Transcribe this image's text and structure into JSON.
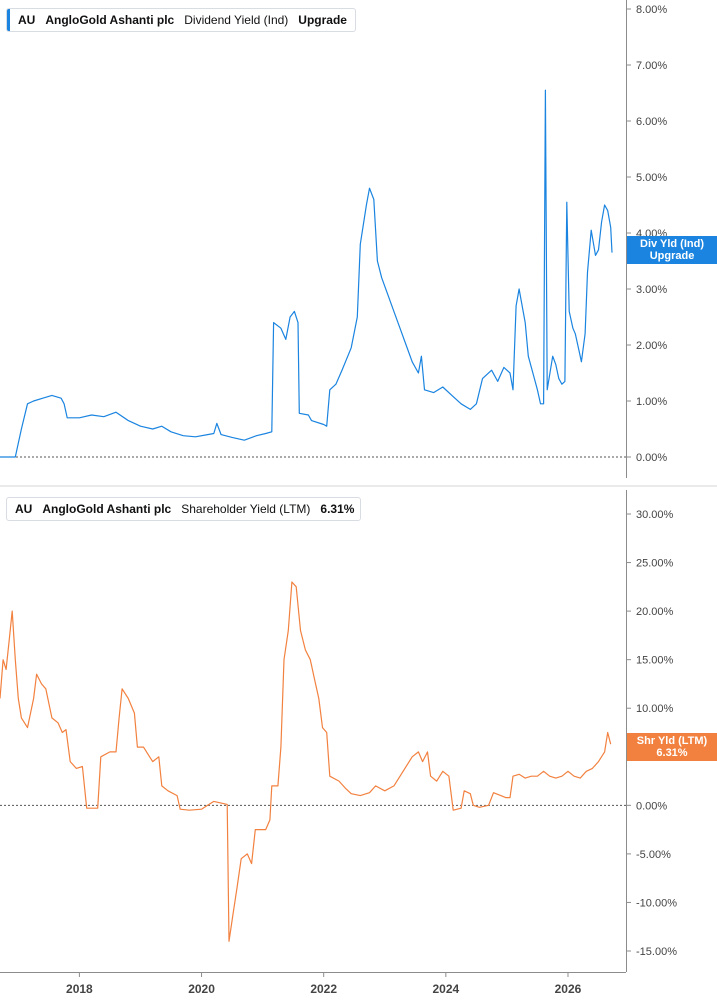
{
  "chart_data": [
    {
      "type": "line",
      "legend": {
        "ticker": "AU",
        "company": "AngloGold Ashanti plc",
        "metric": "Dividend Yield (Ind)",
        "value": "Upgrade"
      },
      "badge": {
        "line1": "Div Yld (Ind)",
        "line2": "Upgrade"
      },
      "color": "#1a84e0",
      "ylim": [
        0,
        8
      ],
      "yticks": [
        {
          "v": 0,
          "label": "0.00%"
        },
        {
          "v": 1,
          "label": "1.00%"
        },
        {
          "v": 2,
          "label": "2.00%"
        },
        {
          "v": 3,
          "label": "3.00%"
        },
        {
          "v": 4,
          "label": "4.00%"
        },
        {
          "v": 5,
          "label": "5.00%"
        },
        {
          "v": 6,
          "label": "6.00%"
        },
        {
          "v": 7,
          "label": "7.00%"
        },
        {
          "v": 8,
          "label": "8.00%"
        }
      ],
      "points": [
        [
          2016.7,
          0.0
        ],
        [
          2016.95,
          0.0
        ],
        [
          2017.05,
          0.5
        ],
        [
          2017.15,
          0.95
        ],
        [
          2017.25,
          1.0
        ],
        [
          2017.4,
          1.05
        ],
        [
          2017.55,
          1.1
        ],
        [
          2017.7,
          1.05
        ],
        [
          2017.75,
          0.95
        ],
        [
          2017.8,
          0.7
        ],
        [
          2018.0,
          0.7
        ],
        [
          2018.2,
          0.75
        ],
        [
          2018.4,
          0.72
        ],
        [
          2018.6,
          0.8
        ],
        [
          2018.8,
          0.65
        ],
        [
          2019.0,
          0.55
        ],
        [
          2019.2,
          0.5
        ],
        [
          2019.35,
          0.55
        ],
        [
          2019.5,
          0.45
        ],
        [
          2019.7,
          0.38
        ],
        [
          2019.9,
          0.36
        ],
        [
          2020.1,
          0.4
        ],
        [
          2020.2,
          0.42
        ],
        [
          2020.25,
          0.6
        ],
        [
          2020.32,
          0.4
        ],
        [
          2020.5,
          0.35
        ],
        [
          2020.7,
          0.3
        ],
        [
          2020.9,
          0.38
        ],
        [
          2021.05,
          0.42
        ],
        [
          2021.15,
          0.45
        ],
        [
          2021.18,
          2.4
        ],
        [
          2021.3,
          2.3
        ],
        [
          2021.38,
          2.1
        ],
        [
          2021.45,
          2.5
        ],
        [
          2021.52,
          2.6
        ],
        [
          2021.58,
          2.4
        ],
        [
          2021.6,
          0.78
        ],
        [
          2021.75,
          0.75
        ],
        [
          2021.8,
          0.65
        ],
        [
          2022.0,
          0.58
        ],
        [
          2022.05,
          0.55
        ],
        [
          2022.1,
          1.2
        ],
        [
          2022.2,
          1.3
        ],
        [
          2022.3,
          1.55
        ],
        [
          2022.45,
          1.95
        ],
        [
          2022.55,
          2.5
        ],
        [
          2022.6,
          3.8
        ],
        [
          2022.7,
          4.5
        ],
        [
          2022.75,
          4.8
        ],
        [
          2022.82,
          4.6
        ],
        [
          2022.88,
          3.5
        ],
        [
          2022.95,
          3.2
        ],
        [
          2023.05,
          2.9
        ],
        [
          2023.15,
          2.6
        ],
        [
          2023.25,
          2.3
        ],
        [
          2023.35,
          2.0
        ],
        [
          2023.45,
          1.7
        ],
        [
          2023.55,
          1.5
        ],
        [
          2023.6,
          1.8
        ],
        [
          2023.65,
          1.2
        ],
        [
          2023.8,
          1.15
        ],
        [
          2023.95,
          1.25
        ],
        [
          2024.1,
          1.1
        ],
        [
          2024.25,
          0.95
        ],
        [
          2024.4,
          0.85
        ],
        [
          2024.5,
          0.95
        ],
        [
          2024.6,
          1.4
        ],
        [
          2024.75,
          1.55
        ],
        [
          2024.85,
          1.35
        ],
        [
          2024.95,
          1.6
        ],
        [
          2025.05,
          1.5
        ],
        [
          2025.1,
          1.2
        ],
        [
          2025.15,
          2.7
        ],
        [
          2025.2,
          3.0
        ],
        [
          2025.3,
          2.4
        ],
        [
          2025.35,
          1.8
        ],
        [
          2025.45,
          1.4
        ],
        [
          2025.5,
          1.2
        ],
        [
          2025.55,
          0.95
        ],
        [
          2025.6,
          0.95
        ],
        [
          2025.63,
          6.55
        ],
        [
          2025.66,
          1.2
        ],
        [
          2025.75,
          1.8
        ],
        [
          2025.8,
          1.65
        ],
        [
          2025.85,
          1.4
        ],
        [
          2025.9,
          1.3
        ],
        [
          2025.95,
          1.35
        ],
        [
          2025.98,
          4.55
        ],
        [
          2026.02,
          2.6
        ],
        [
          2026.08,
          2.3
        ],
        [
          2026.12,
          2.2
        ],
        [
          2026.18,
          1.9
        ],
        [
          2026.22,
          1.7
        ],
        [
          2026.28,
          2.2
        ],
        [
          2026.32,
          3.3
        ],
        [
          2026.38,
          4.05
        ],
        [
          2026.45,
          3.6
        ],
        [
          2026.5,
          3.7
        ],
        [
          2026.55,
          4.2
        ],
        [
          2026.6,
          4.5
        ],
        [
          2026.65,
          4.4
        ],
        [
          2026.7,
          4.1
        ],
        [
          2026.72,
          3.65
        ]
      ]
    },
    {
      "type": "line",
      "legend": {
        "ticker": "AU",
        "company": "AngloGold Ashanti plc",
        "metric": "Shareholder Yield (LTM)",
        "value": "6.31%"
      },
      "badge": {
        "line1": "Shr Yld (LTM)",
        "line2": "6.31%"
      },
      "color": "#f2813f",
      "ylim": [
        -15,
        30
      ],
      "yticks": [
        {
          "v": -15,
          "label": "-15.00%"
        },
        {
          "v": -10,
          "label": "-10.00%"
        },
        {
          "v": -5,
          "label": "-5.00%"
        },
        {
          "v": 0,
          "label": "0.00%"
        },
        {
          "v": 5,
          "label": "5.00%"
        },
        {
          "v": 10,
          "label": "10.00%"
        },
        {
          "v": 15,
          "label": "15.00%"
        },
        {
          "v": 20,
          "label": "20.00%"
        },
        {
          "v": 25,
          "label": "25.00%"
        },
        {
          "v": 30,
          "label": "30.00%"
        }
      ],
      "points": [
        [
          2016.7,
          11.0
        ],
        [
          2016.75,
          15.0
        ],
        [
          2016.8,
          14.0
        ],
        [
          2016.85,
          17.0
        ],
        [
          2016.9,
          20.0
        ],
        [
          2016.95,
          15.0
        ],
        [
          2017.0,
          11.0
        ],
        [
          2017.05,
          9.0
        ],
        [
          2017.15,
          8.0
        ],
        [
          2017.25,
          11.0
        ],
        [
          2017.3,
          13.5
        ],
        [
          2017.38,
          12.5
        ],
        [
          2017.45,
          12.0
        ],
        [
          2017.55,
          9.0
        ],
        [
          2017.65,
          8.5
        ],
        [
          2017.72,
          7.5
        ],
        [
          2017.78,
          7.8
        ],
        [
          2017.85,
          4.5
        ],
        [
          2017.95,
          3.8
        ],
        [
          2018.05,
          4.0
        ],
        [
          2018.12,
          -0.3
        ],
        [
          2018.3,
          -0.3
        ],
        [
          2018.35,
          5.0
        ],
        [
          2018.5,
          5.5
        ],
        [
          2018.6,
          5.5
        ],
        [
          2018.65,
          9.0
        ],
        [
          2018.7,
          12.0
        ],
        [
          2018.8,
          11.0
        ],
        [
          2018.9,
          9.5
        ],
        [
          2018.95,
          6.0
        ],
        [
          2019.05,
          6.0
        ],
        [
          2019.15,
          5.0
        ],
        [
          2019.2,
          4.5
        ],
        [
          2019.3,
          5.0
        ],
        [
          2019.35,
          2.0
        ],
        [
          2019.45,
          1.5
        ],
        [
          2019.6,
          1.0
        ],
        [
          2019.65,
          -0.4
        ],
        [
          2019.8,
          -0.5
        ],
        [
          2020.0,
          -0.4
        ],
        [
          2020.1,
          0.0
        ],
        [
          2020.2,
          0.4
        ],
        [
          2020.35,
          0.2
        ],
        [
          2020.42,
          0.1
        ],
        [
          2020.45,
          -14.0
        ],
        [
          2020.52,
          -11.0
        ],
        [
          2020.58,
          -8.5
        ],
        [
          2020.65,
          -5.5
        ],
        [
          2020.75,
          -5.0
        ],
        [
          2020.82,
          -6.0
        ],
        [
          2020.88,
          -2.5
        ],
        [
          2020.95,
          -2.5
        ],
        [
          2021.05,
          -2.5
        ],
        [
          2021.12,
          -1.5
        ],
        [
          2021.15,
          2.0
        ],
        [
          2021.25,
          2.0
        ],
        [
          2021.3,
          6.0
        ],
        [
          2021.35,
          15.0
        ],
        [
          2021.42,
          18.0
        ],
        [
          2021.48,
          23.0
        ],
        [
          2021.55,
          22.5
        ],
        [
          2021.62,
          18.0
        ],
        [
          2021.7,
          16.0
        ],
        [
          2021.78,
          15.0
        ],
        [
          2021.85,
          13.0
        ],
        [
          2021.92,
          11.0
        ],
        [
          2021.98,
          8.0
        ],
        [
          2022.05,
          7.5
        ],
        [
          2022.1,
          3.0
        ],
        [
          2022.25,
          2.5
        ],
        [
          2022.35,
          1.8
        ],
        [
          2022.45,
          1.2
        ],
        [
          2022.6,
          1.0
        ],
        [
          2022.75,
          1.3
        ],
        [
          2022.85,
          2.0
        ],
        [
          2023.0,
          1.5
        ],
        [
          2023.15,
          2.0
        ],
        [
          2023.3,
          3.5
        ],
        [
          2023.45,
          5.0
        ],
        [
          2023.55,
          5.5
        ],
        [
          2023.62,
          4.5
        ],
        [
          2023.7,
          5.5
        ],
        [
          2023.75,
          3.0
        ],
        [
          2023.85,
          2.5
        ],
        [
          2023.95,
          3.5
        ],
        [
          2024.05,
          3.0
        ],
        [
          2024.12,
          -0.5
        ],
        [
          2024.25,
          -0.3
        ],
        [
          2024.3,
          1.5
        ],
        [
          2024.4,
          1.2
        ],
        [
          2024.45,
          0.0
        ],
        [
          2024.55,
          -0.2
        ],
        [
          2024.7,
          0.0
        ],
        [
          2024.78,
          1.3
        ],
        [
          2024.9,
          1.0
        ],
        [
          2024.98,
          0.8
        ],
        [
          2025.05,
          0.8
        ],
        [
          2025.1,
          3.0
        ],
        [
          2025.2,
          3.2
        ],
        [
          2025.3,
          2.8
        ],
        [
          2025.4,
          3.0
        ],
        [
          2025.5,
          3.0
        ],
        [
          2025.6,
          3.5
        ],
        [
          2025.7,
          3.0
        ],
        [
          2025.8,
          2.8
        ],
        [
          2025.9,
          3.0
        ],
        [
          2026.0,
          3.5
        ],
        [
          2026.1,
          3.0
        ],
        [
          2026.2,
          2.8
        ],
        [
          2026.3,
          3.5
        ],
        [
          2026.4,
          3.8
        ],
        [
          2026.5,
          4.5
        ],
        [
          2026.6,
          5.5
        ],
        [
          2026.65,
          7.5
        ],
        [
          2026.7,
          6.3
        ]
      ]
    }
  ],
  "x_axis": {
    "range": [
      2016.7,
      2026.95
    ],
    "ticks": [
      {
        "v": 2018,
        "label": "2018"
      },
      {
        "v": 2020,
        "label": "2020"
      },
      {
        "v": 2022,
        "label": "2022"
      },
      {
        "v": 2024,
        "label": "2024"
      },
      {
        "v": 2026,
        "label": "2026"
      }
    ]
  },
  "colors": {
    "axis": "#8c8c8c",
    "tick_text": "#444444",
    "zero_line": "#555555",
    "divider": "#d4d4d4"
  }
}
